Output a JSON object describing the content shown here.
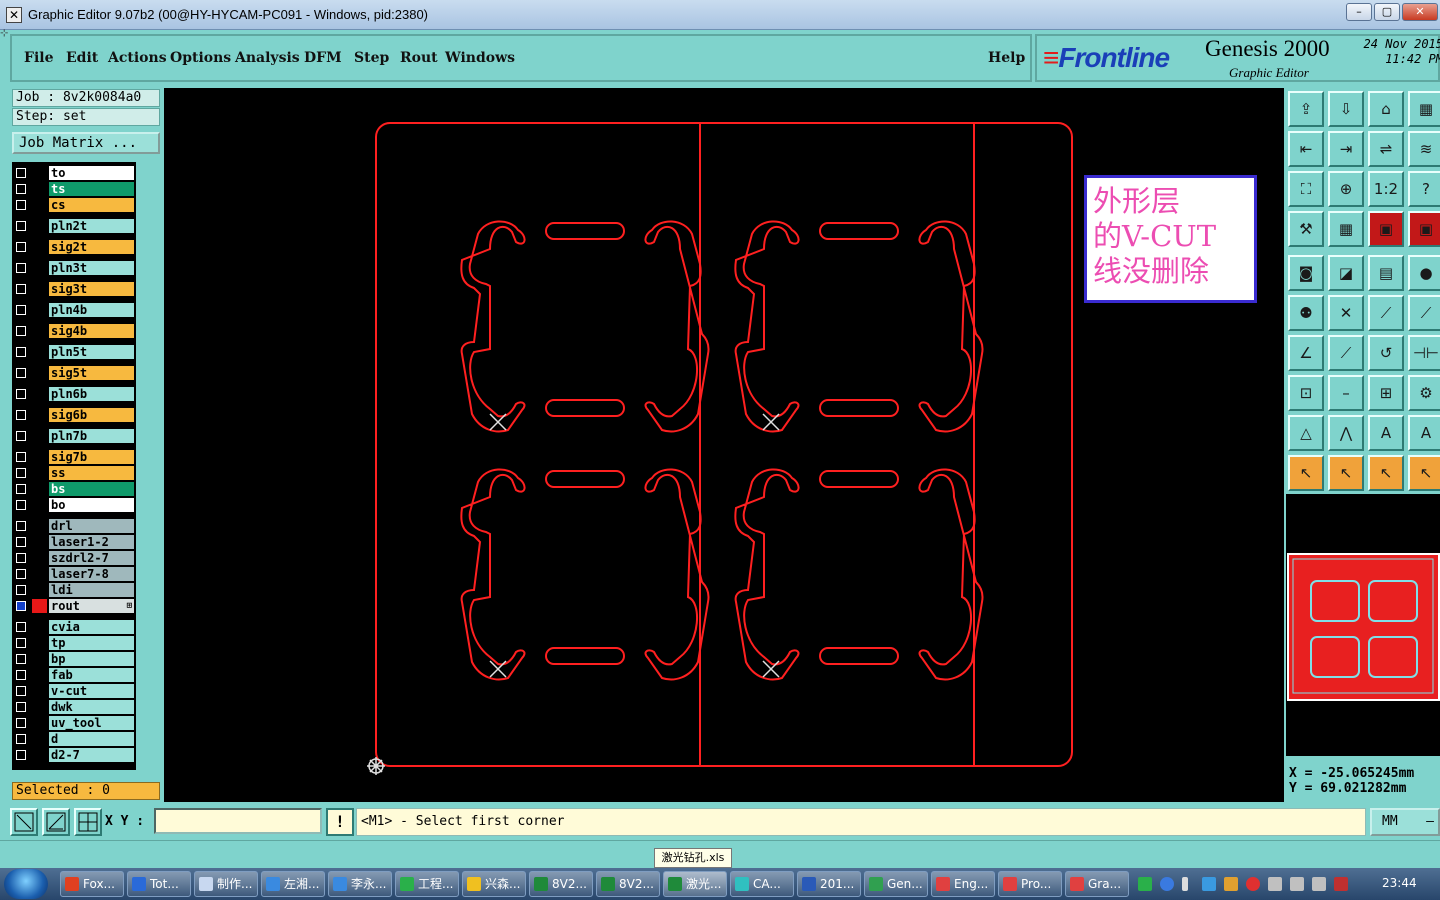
{
  "window": {
    "title": "Graphic Editor 9.07b2 (00@HY-HYCAM-PC091 - Windows, pid:2380)",
    "app_icon": "x-icon",
    "buttons": [
      "–",
      "▢",
      "✕"
    ]
  },
  "menubar": {
    "items": [
      "File",
      "Edit",
      "Actions",
      "Options",
      "Analysis",
      "DFM",
      "Step",
      "Rout",
      "Windows"
    ],
    "help": "Help"
  },
  "brand": {
    "logo": "Frontline",
    "product": "Genesis 2000",
    "subtitle": "Graphic Editor",
    "date": "24 Nov 2015",
    "time": "11:42 PM"
  },
  "job": {
    "job_line": "Job : 8v2k0084a0",
    "step_line": "Step: set",
    "matrix_button": "Job Matrix ..."
  },
  "layers": [
    {
      "name": "to",
      "color": "#ffffff",
      "gap": 0
    },
    {
      "name": "ts",
      "color": "#0f9a6a",
      "gap": 0
    },
    {
      "name": "cs",
      "color": "#f7b93f",
      "gap": 0
    },
    {
      "name": "pln2t",
      "color": "#9be0d9",
      "gap": 1
    },
    {
      "name": "sig2t",
      "color": "#f7b93f",
      "gap": 1
    },
    {
      "name": "pln3t",
      "color": "#9be0d9",
      "gap": 1
    },
    {
      "name": "sig3t",
      "color": "#f7b93f",
      "gap": 1
    },
    {
      "name": "pln4b",
      "color": "#9be0d9",
      "gap": 1
    },
    {
      "name": "sig4b",
      "color": "#f7b93f",
      "gap": 1
    },
    {
      "name": "pln5t",
      "color": "#9be0d9",
      "gap": 1
    },
    {
      "name": "sig5t",
      "color": "#f7b93f",
      "gap": 1
    },
    {
      "name": "pln6b",
      "color": "#9be0d9",
      "gap": 1
    },
    {
      "name": "sig6b",
      "color": "#f7b93f",
      "gap": 1
    },
    {
      "name": "pln7b",
      "color": "#9be0d9",
      "gap": 1
    },
    {
      "name": "sig7b",
      "color": "#f7b93f",
      "gap": 1
    },
    {
      "name": "ss",
      "color": "#f7b93f",
      "gap": 0
    },
    {
      "name": "bs",
      "color": "#0f9a6a",
      "gap": 0
    },
    {
      "name": "bo",
      "color": "#ffffff",
      "gap": 0
    },
    {
      "name": "drl",
      "color": "#9fb8bc",
      "gap": 1
    },
    {
      "name": "laser1-2",
      "color": "#9fb8bc",
      "gap": 0
    },
    {
      "name": "szdrl2-7",
      "color": "#9fb8bc",
      "gap": 0
    },
    {
      "name": "laser7-8",
      "color": "#9fb8bc",
      "gap": 0
    },
    {
      "name": "ldi",
      "color": "#9fb8bc",
      "gap": 0
    },
    {
      "name": "rout",
      "color": "#d8e0e0",
      "gap": 0,
      "active": true,
      "swatch": "#e81818",
      "marker": "⊞"
    },
    {
      "name": "cvia",
      "color": "#9be0d9",
      "gap": 1
    },
    {
      "name": "tp",
      "color": "#9be0d9",
      "gap": 0
    },
    {
      "name": "bp",
      "color": "#9be0d9",
      "gap": 0
    },
    {
      "name": "fab",
      "color": "#9be0d9",
      "gap": 0
    },
    {
      "name": "v-cut",
      "color": "#9be0d9",
      "gap": 0
    },
    {
      "name": "dwk",
      "color": "#9be0d9",
      "gap": 0
    },
    {
      "name": "uv_tool",
      "color": "#9be0d9",
      "gap": 0
    },
    {
      "name": "d",
      "color": "#9be0d9",
      "gap": 0
    },
    {
      "name": "d2-7",
      "color": "#9be0d9",
      "gap": 0
    }
  ],
  "selected": "Selected : 0",
  "annotation": "外形层的V-CUT线没删除",
  "coords": {
    "x": "X = -25.065245mm",
    "y": "Y = 69.021282mm"
  },
  "command": {
    "xy_label": "X Y :",
    "xy_value": "",
    "warn": "!",
    "prompt": "<M1> - Select first corner",
    "unit": "MM"
  },
  "tooltip": "激光钻孔.xls",
  "taskbar": {
    "items": [
      {
        "label": "Fox...",
        "icon": "#e04020"
      },
      {
        "label": "Tot...",
        "icon": "#2a6ad8"
      },
      {
        "label": "制作...",
        "icon": "#c8d8f0"
      },
      {
        "label": "左湘...",
        "icon": "#3a8ae0"
      },
      {
        "label": "李永...",
        "icon": "#3a8ae0"
      },
      {
        "label": "工程...",
        "icon": "#2ab04a"
      },
      {
        "label": "兴森...",
        "icon": "#f0c020"
      },
      {
        "label": "8V2...",
        "icon": "#1f8a3a"
      },
      {
        "label": "8V2...",
        "icon": "#1f8a3a"
      },
      {
        "label": "激光...",
        "icon": "#1f8a3a",
        "active": true
      },
      {
        "label": "CA...",
        "icon": "#30c0c0"
      },
      {
        "label": "201...",
        "icon": "#2a5ab8"
      },
      {
        "label": "Gen...",
        "icon": "#30a050"
      },
      {
        "label": "Eng...",
        "icon": "#e04040"
      },
      {
        "label": "Pro...",
        "icon": "#e04040"
      },
      {
        "label": "Gra...",
        "icon": "#e04040"
      }
    ],
    "clock": "23:44"
  }
}
